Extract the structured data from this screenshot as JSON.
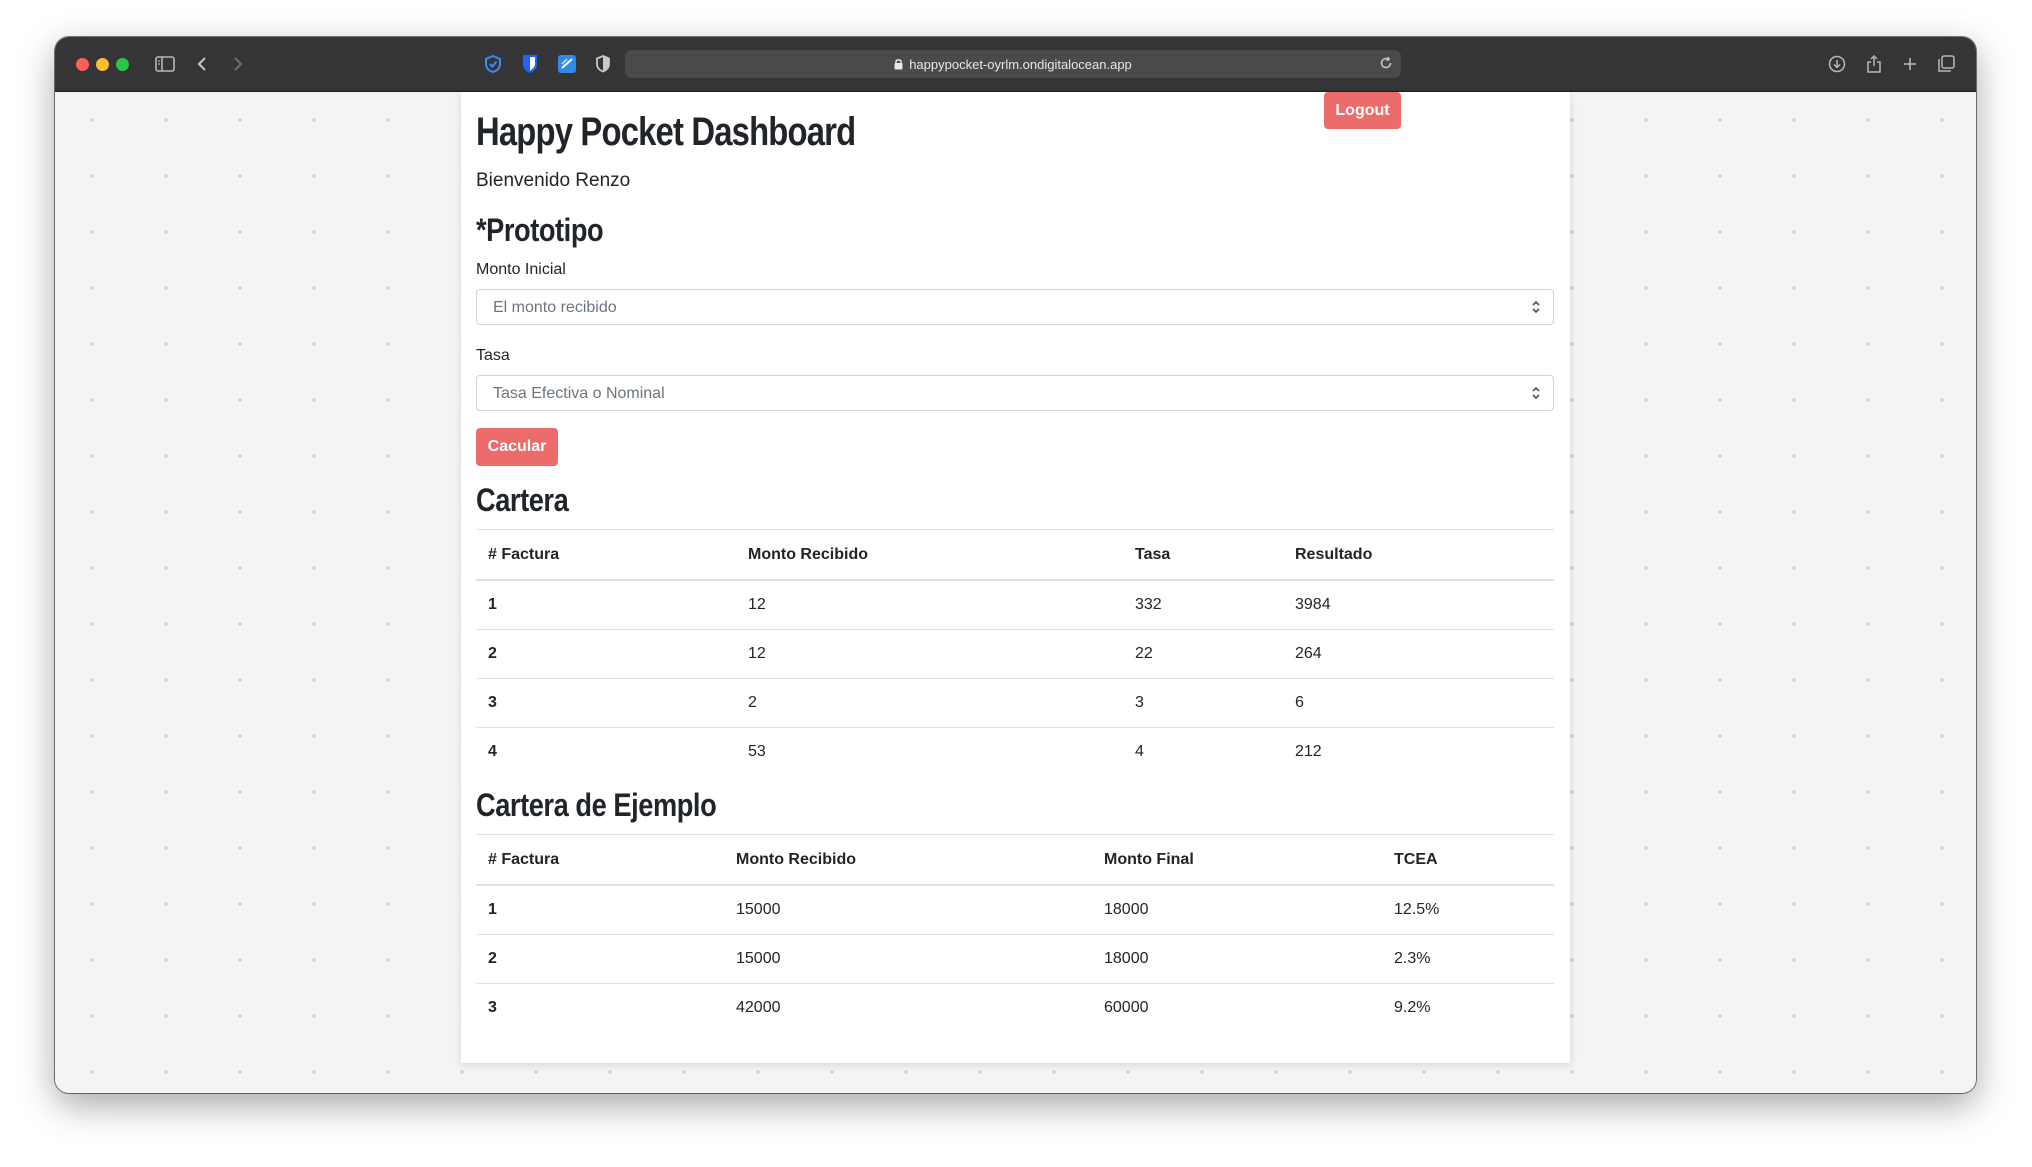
{
  "browser": {
    "url": "happypocket-oyrlm.ondigitalocean.app"
  },
  "header": {
    "logout_label": "Logout",
    "title": "Happy Pocket Dashboard",
    "welcome": "Bienvenido Renzo"
  },
  "prototype": {
    "heading": "*Prototipo",
    "monto_label": "Monto Inicial",
    "monto_value": "El monto recibido",
    "tasa_label": "Tasa",
    "tasa_value": "Tasa Efectiva o Nominal",
    "calc_label": "Cacular"
  },
  "cartera": {
    "heading": "Cartera",
    "columns": [
      "# Factura",
      "Monto Recibido",
      "Tasa",
      "Resultado"
    ],
    "rows": [
      [
        "1",
        "12",
        "332",
        "3984"
      ],
      [
        "2",
        "12",
        "22",
        "264"
      ],
      [
        "3",
        "2",
        "3",
        "6"
      ],
      [
        "4",
        "53",
        "4",
        "212"
      ]
    ]
  },
  "ejemplo": {
    "heading": "Cartera de Ejemplo",
    "columns": [
      "# Factura",
      "Monto Recibido",
      "Monto Final",
      "TCEA"
    ],
    "rows": [
      [
        "1",
        "15000",
        "18000",
        "12.5%"
      ],
      [
        "2",
        "15000",
        "18000",
        "2.3%"
      ],
      [
        "3",
        "42000",
        "60000",
        "9.2%"
      ]
    ]
  },
  "colors": {
    "accent": "#ec6b6b"
  }
}
